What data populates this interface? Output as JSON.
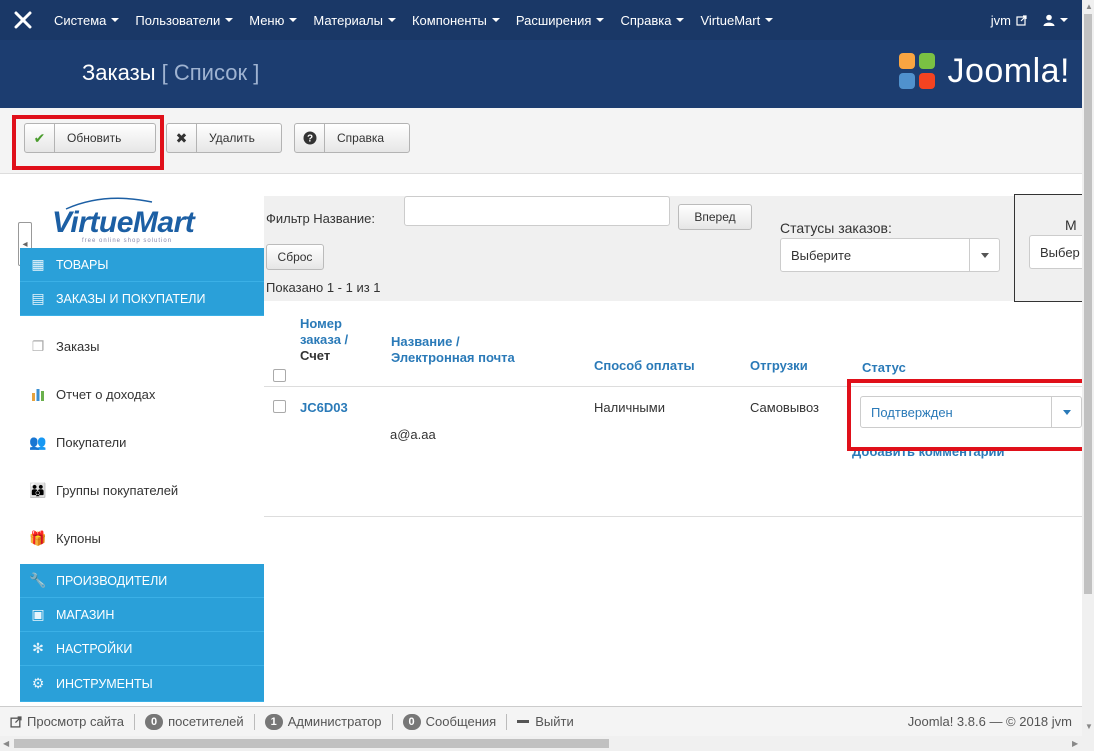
{
  "topnav": {
    "menu": [
      "Система",
      "Пользователи",
      "Меню",
      "Материалы",
      "Компоненты",
      "Расширения",
      "Справка",
      "VirtueMart"
    ],
    "user_link": "jvm"
  },
  "header": {
    "title": "Заказы",
    "subtitle": "[ Список ]",
    "brand": "Joomla!"
  },
  "toolbar": {
    "update": "Обновить",
    "delete": "Удалить",
    "help": "Справка"
  },
  "sidebar": {
    "logo": "VirtueMart",
    "tagline": "free online shop solution",
    "sections": [
      {
        "label": "ТОВАРЫ"
      },
      {
        "label": "ЗАКАЗЫ И ПОКУПАТЕЛИ"
      }
    ],
    "subitems": [
      {
        "label": "Заказы"
      },
      {
        "label": "Отчет о доходах"
      },
      {
        "label": "Покупатели"
      },
      {
        "label": "Группы покупателей"
      },
      {
        "label": "Купоны"
      }
    ],
    "bottom_sections": [
      {
        "label": "ПРОИЗВОДИТЕЛИ"
      },
      {
        "label": "МАГАЗИН"
      },
      {
        "label": "НАСТРОЙКИ"
      },
      {
        "label": "ИНСТРУМЕНТЫ"
      }
    ]
  },
  "filter": {
    "name_label": "Фильтр Название:",
    "name_value": "",
    "go": "Вперед",
    "reset": "Сброс",
    "status_label": "Статусы заказов:",
    "status_select": "Выберите",
    "clipped_label": "М",
    "clipped_select": "Выбер",
    "shown": "Показано 1 - 1 из 1"
  },
  "table": {
    "headers": {
      "order_num": "Номер заказа /",
      "invoice": "Счет",
      "name": "Название /",
      "email": "Электронная почта",
      "payment": "Способ оплаты",
      "shipping": "Отгрузки",
      "status": "Статус"
    },
    "rows": [
      {
        "order": "JC6D03",
        "email": "a@a.aa",
        "payment": "Наличными",
        "shipping": "Самовывоз",
        "status": "Подтвержден",
        "comment": "Добавить комментарий"
      }
    ]
  },
  "footer": {
    "view_site": "Просмотр сайта",
    "visitors_count": "0",
    "visitors": "посетителей",
    "admins_count": "1",
    "admins": "Администратор",
    "messages_count": "0",
    "messages": "Сообщения",
    "logout": "Выйти",
    "version": "Joomla! 3.8.6 — © 2018 jvm"
  },
  "colors": {
    "nav_bg": "#1a3867",
    "header_bg": "#1c3d70",
    "sidebar_section": "#2aa0d9",
    "link": "#2a7ab8",
    "highlight": "#e0101a"
  }
}
